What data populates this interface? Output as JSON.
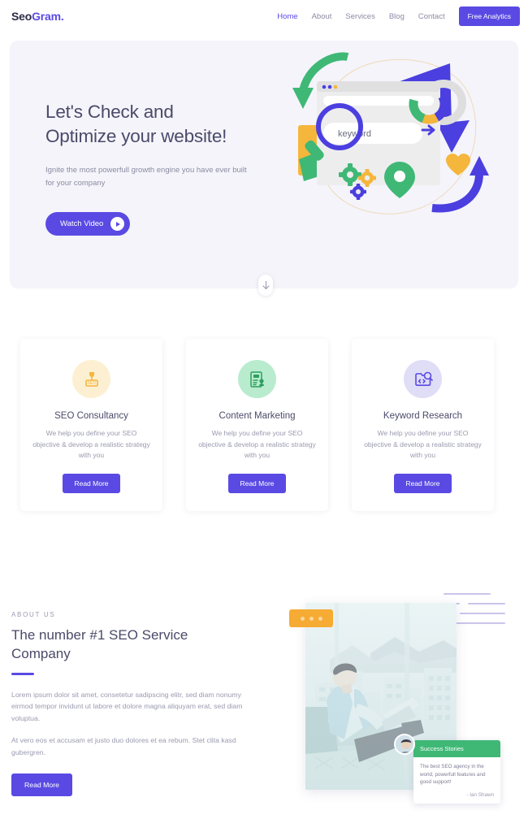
{
  "brand": {
    "part1": "Seo",
    "part2": "Gram."
  },
  "nav": {
    "links": [
      {
        "label": "Home",
        "active": true
      },
      {
        "label": "About",
        "active": false
      },
      {
        "label": "Services",
        "active": false
      },
      {
        "label": "Blog",
        "active": false
      },
      {
        "label": "Contact",
        "active": false
      }
    ],
    "cta_label": "Free Analytics"
  },
  "hero": {
    "title_line1": "Let's Check and",
    "title_line2": "Optimize your website!",
    "subtitle": "Ignite the most powerfull growth engine you have ever built for your company",
    "button_label": "Watch Video",
    "illustration": {
      "search_placeholder": "keyword",
      "icon_names": [
        "browser-window",
        "magnifier-icon",
        "gear-icon",
        "location-pin-icon",
        "heart-icon",
        "donut-chart",
        "arrow-curve-green",
        "arrow-curve-purple"
      ]
    }
  },
  "scroll_down": {
    "icon": "arrow-down-icon"
  },
  "services": {
    "cards": [
      {
        "title": "SEO Consultancy",
        "desc": "We help you define your SEO objective & develop a realistic strategy with you",
        "button_label": "Read More",
        "icon_name": "seo-trophy-icon",
        "icon_bg": "#fdf0d2",
        "icon_color": "#f5b63c"
      },
      {
        "title": "Content Marketing",
        "desc": "We help you define your SEO objective & develop a realistic strategy with you",
        "button_label": "Read More",
        "icon_name": "seo-document-icon",
        "icon_bg": "#b9ecce",
        "icon_color": "#3fb876"
      },
      {
        "title": "Keyword Research",
        "desc": "We help you define your SEO objective & develop a realistic strategy with you",
        "button_label": "Read More",
        "icon_name": "code-search-icon",
        "icon_bg": "#e0ddf7",
        "icon_color": "#5a4ae3"
      }
    ]
  },
  "about": {
    "eyebrow": "ABOUT US",
    "title": "The number #1 SEO Service Company",
    "paragraph1": "Lorem ipsum dolor sit amet, consetetur sadipscing elitr, sed diam nonumy eirmod tempor invidunt ut labore et dolore magna aliquyam erat, sed diam voluptua.",
    "paragraph2": "At vero eos et accusam et justo duo dolores et ea rebum. Stet clita kasd gubergren.",
    "button_label": "Read More",
    "photo_alt": "man-on-sofa-with-laptop-photo",
    "testimonial": {
      "header": "Success Stories",
      "quote": "The best SEO agency in the world, powerfull features and good support!",
      "author": "- Ian Shawn"
    }
  },
  "colors": {
    "primary": "#5a4ae3",
    "green": "#3fb876",
    "yellow": "#f5ab34",
    "hero_bg": "#f4f4fa",
    "heading": "#4a4a6a",
    "muted": "#9a9ab0"
  }
}
